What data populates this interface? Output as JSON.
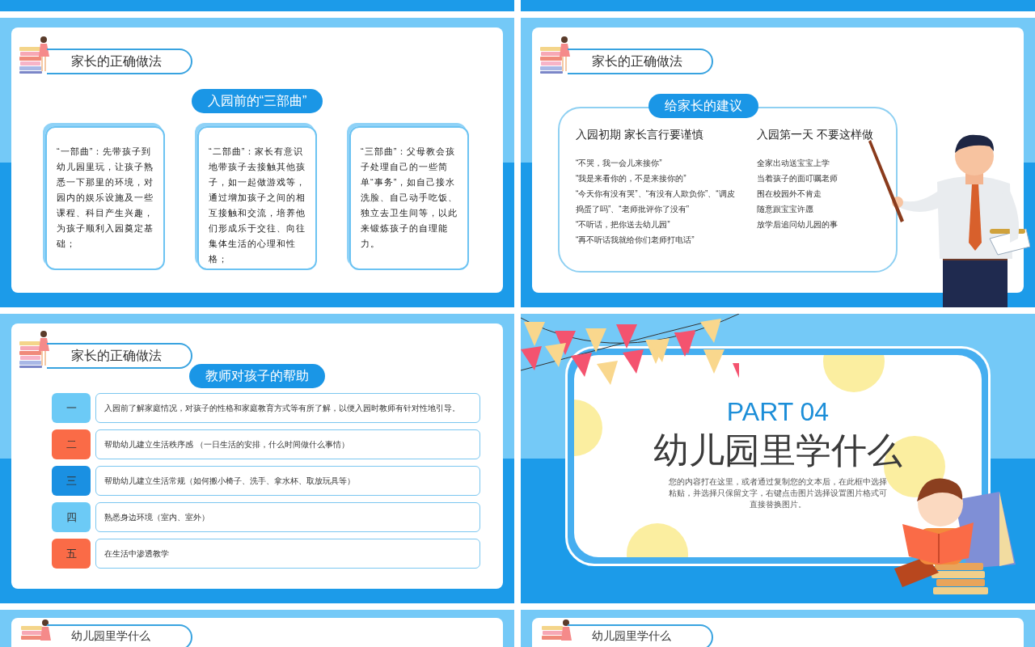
{
  "slides": [
    {
      "kind": "partial_top"
    },
    {
      "kind": "partial_top"
    },
    {
      "kind": "three_steps",
      "header": "家长的正确做法",
      "banner": "入园前的“三部曲”",
      "cards": [
        "“一部曲”：先带孩子到幼儿园里玩，让孩子熟悉一下那里的环境，对园内的娱乐设施及一些课程、科目产生兴趣，为孩子顺利入园奠定基础；",
        "“二部曲”：家长有意识地带孩子去接触其他孩子，如一起做游戏等，通过增加孩子之间的相互接触和交流，培养他们形成乐于交往、向往集体生活的心理和性格；",
        "“三部曲”：父母教会孩子处理自己的一些简单“事务”，如自己接水洗脸、自己动手吃饭、独立去卫生间等，以此来锻炼孩子的自理能力。"
      ]
    },
    {
      "kind": "advice",
      "header": "家长的正确做法",
      "banner": "给家长的建议",
      "columns": [
        {
          "heading": "入园初期 家长言行要谨慎",
          "lines": [
            "“不哭，我一会儿来接你”",
            "“我是来看你的，不是来接你的”",
            "“今天你有没有哭”、“有没有人欺负你”、“调皮捣蛋了吗”、“老师批评你了没有”",
            "“不听话，把你送去幼儿园”",
            "“再不听话我就给你们老师打电话”"
          ]
        },
        {
          "heading": "入园第一天 不要这样做",
          "lines": [
            "全家出动送宝宝上学",
            "当着孩子的面叮嘱老师",
            "围在校园外不肯走",
            "随意跟宝宝许愿",
            "放学后追问幼儿园的事"
          ]
        }
      ]
    },
    {
      "kind": "help_list",
      "header": "家长的正确做法",
      "banner": "教师对孩子的帮助",
      "items": [
        {
          "number": "一",
          "text": "入园前了解家庭情况，对孩子的性格和家庭教育方式等有所了解，以便入园时教师有针对性地引导。",
          "color": "#6ccaf6"
        },
        {
          "number": "二",
          "text": "帮助幼儿建立生活秩序感 （一日生活的安排，什么时间做什么事情）",
          "color": "#fa6b47"
        },
        {
          "number": "三",
          "text": "帮助幼儿建立生活常规（如何搬小椅子、洗手、拿水杯、取放玩具等）",
          "color": "#1a90e2"
        },
        {
          "number": "四",
          "text": "熟悉身边环境（室内、室外）",
          "color": "#6ccaf6"
        },
        {
          "number": "五",
          "text": "在生活中渗透教学",
          "color": "#fa6b47"
        }
      ]
    },
    {
      "kind": "section_cover",
      "part": "PART 04",
      "title": "幼儿园里学什么",
      "body": "您的内容打在这里，或者通过复制您的文本后，在此框中选择粘贴，并选择只保留文字，右键点击图片选择设置图片格式可直接替换图片。"
    },
    {
      "kind": "partial_bottom",
      "header": "幼儿园里学什么"
    },
    {
      "kind": "partial_bottom",
      "header": "幼儿园里学什么"
    }
  ]
}
